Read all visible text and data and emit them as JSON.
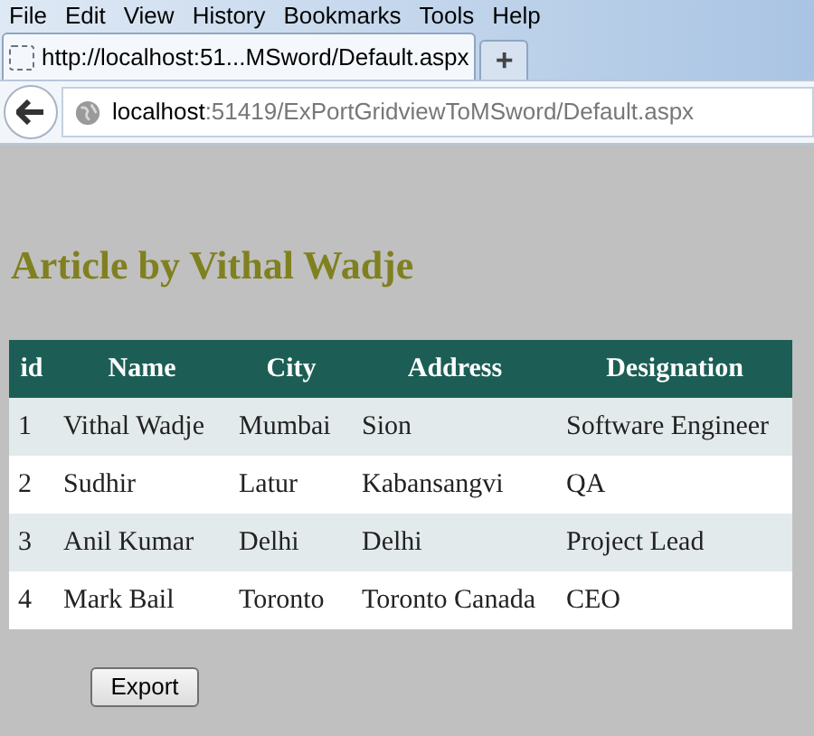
{
  "menu": [
    "File",
    "Edit",
    "View",
    "History",
    "Bookmarks",
    "Tools",
    "Help"
  ],
  "tabs": [
    {
      "title": "http://localhost:51...MSword/Default.aspx",
      "selected": true
    }
  ],
  "new_tab": "+",
  "address": {
    "host": "localhost",
    "rest": ":51419/ExPortGridviewToMSword/Default.aspx"
  },
  "heading": "Article by Vithal Wadje",
  "table": {
    "columns": [
      "id",
      "Name",
      "City",
      "Address",
      "Designation"
    ],
    "rows": [
      [
        "1",
        "Vithal Wadje",
        "Mumbai",
        "Sion",
        "Software Engineer"
      ],
      [
        "2",
        "Sudhir",
        "Latur",
        "Kabansangvi",
        "QA"
      ],
      [
        "3",
        "Anil Kumar",
        "Delhi",
        "Delhi",
        "Project Lead"
      ],
      [
        "4",
        "Mark Bail",
        "Toronto",
        "Toronto Canada",
        "CEO"
      ]
    ]
  },
  "export_button": "Export"
}
